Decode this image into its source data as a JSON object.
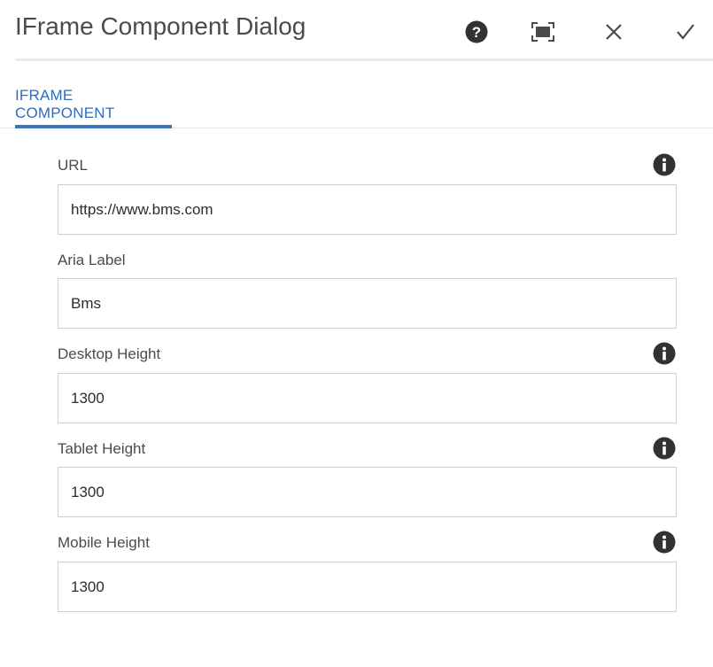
{
  "dialog": {
    "title": "IFrame Component Dialog",
    "actions": [
      {
        "name": "help",
        "icon": "help-icon"
      },
      {
        "name": "fullscreen",
        "icon": "fullscreen-icon"
      },
      {
        "name": "close",
        "icon": "close-icon"
      },
      {
        "name": "done",
        "icon": "checkmark-icon"
      }
    ]
  },
  "tabs": [
    {
      "label": "IFRAME COMPONENT",
      "active": true
    }
  ],
  "fields": {
    "url": {
      "label": "URL",
      "value": "https://www.bms.com",
      "has_info": true
    },
    "aria_label": {
      "label": "Aria Label",
      "value": "Bms",
      "has_info": false
    },
    "desktop_height": {
      "label": "Desktop Height",
      "value": "1300",
      "has_info": true
    },
    "tablet_height": {
      "label": "Tablet Height",
      "value": "1300",
      "has_info": true
    },
    "mobile_height": {
      "label": "Mobile Height",
      "value": "1300",
      "has_info": true
    }
  },
  "colors": {
    "accent": "#2f6cbc",
    "text": "#4b4b4b",
    "border": "#cfcfcf",
    "icon": "#323232"
  }
}
